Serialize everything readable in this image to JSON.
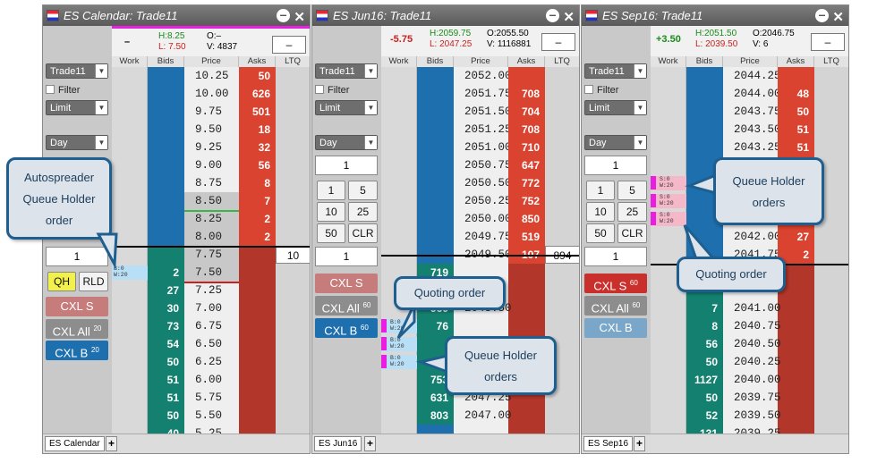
{
  "panels": [
    {
      "title": "ES Calendar: Trade11",
      "change": "–",
      "high": "H:8.25",
      "low": "L: 7.50",
      "open": "O:–",
      "volume": "V: 4837",
      "box": "–",
      "headers": [
        "Work",
        "Bids",
        "Price",
        "Asks",
        "LTQ"
      ],
      "rows": [
        {
          "price": "10.25",
          "bid": "",
          "ask": "50",
          "ltq": ""
        },
        {
          "price": "10.00",
          "bid": "",
          "ask": "626",
          "ltq": ""
        },
        {
          "price": "9.75",
          "bid": "",
          "ask": "501",
          "ltq": ""
        },
        {
          "price": "9.50",
          "bid": "",
          "ask": "18",
          "ltq": ""
        },
        {
          "price": "9.25",
          "bid": "",
          "ask": "32",
          "ltq": ""
        },
        {
          "price": "9.00",
          "bid": "",
          "ask": "56",
          "ltq": ""
        },
        {
          "price": "8.75",
          "bid": "",
          "ask": "8",
          "ltq": ""
        },
        {
          "price": "8.50",
          "bid": "",
          "ask": "7",
          "ltq": ""
        },
        {
          "price": "8.25",
          "bid": "",
          "ask": "2",
          "ltq": ""
        },
        {
          "price": "8.00",
          "bid": "",
          "ask": "2",
          "ltq": ""
        },
        {
          "price": "7.75",
          "bid": "",
          "ask": "",
          "ltq": "10"
        },
        {
          "price": "7.50",
          "bid": "2",
          "ask": "",
          "ltq": ""
        },
        {
          "price": "7.25",
          "bid": "27",
          "ask": "",
          "ltq": ""
        },
        {
          "price": "7.00",
          "bid": "30",
          "ask": "",
          "ltq": ""
        },
        {
          "price": "6.75",
          "bid": "73",
          "ask": "",
          "ltq": ""
        },
        {
          "price": "6.50",
          "bid": "54",
          "ask": "",
          "ltq": ""
        },
        {
          "price": "6.25",
          "bid": "50",
          "ask": "",
          "ltq": ""
        },
        {
          "price": "6.00",
          "bid": "51",
          "ask": "",
          "ltq": ""
        },
        {
          "price": "5.75",
          "bid": "51",
          "ask": "",
          "ltq": ""
        },
        {
          "price": "5.50",
          "bid": "50",
          "ask": "",
          "ltq": ""
        },
        {
          "price": "5.25",
          "bid": "40",
          "ask": "",
          "ltq": ""
        }
      ],
      "account": "Trade11",
      "filter": "Filter",
      "order_type": "Limit",
      "tif": "Day",
      "qty": "1",
      "qh": "QH",
      "rld": "RLD",
      "cxl_s": "CXL S",
      "cxl_all": "CXL All",
      "cxl_all_count": "20",
      "cxl_b": "CXL B",
      "cxl_b_count": "20",
      "tab": "ES Calendar",
      "orders": [
        {
          "line1": "B:0",
          "line2": "W:20"
        }
      ]
    },
    {
      "title": "ES Jun16: Trade11",
      "change": "-5.75",
      "high": "H:2059.75",
      "low": "L: 2047.25",
      "open": "O:2055.50",
      "volume": "V: 1116881",
      "box": "–",
      "headers": [
        "Work",
        "Bids",
        "Price",
        "Asks",
        "LTQ"
      ],
      "rows": [
        {
          "price": "2052.00",
          "bid": "",
          "ask": "",
          "ltq": ""
        },
        {
          "price": "2051.75",
          "bid": "",
          "ask": "708",
          "ltq": ""
        },
        {
          "price": "2051.50",
          "bid": "",
          "ask": "704",
          "ltq": ""
        },
        {
          "price": "2051.25",
          "bid": "",
          "ask": "708",
          "ltq": ""
        },
        {
          "price": "2051.00",
          "bid": "",
          "ask": "710",
          "ltq": ""
        },
        {
          "price": "2050.75",
          "bid": "",
          "ask": "647",
          "ltq": ""
        },
        {
          "price": "2050.50",
          "bid": "",
          "ask": "772",
          "ltq": ""
        },
        {
          "price": "2050.25",
          "bid": "",
          "ask": "752",
          "ltq": ""
        },
        {
          "price": "2050.00",
          "bid": "",
          "ask": "850",
          "ltq": ""
        },
        {
          "price": "2049.75",
          "bid": "",
          "ask": "519",
          "ltq": ""
        },
        {
          "price": "2049.50",
          "bid": "",
          "ask": "107",
          "ltq": "894"
        },
        {
          "price": "",
          "bid": "719",
          "ask": "",
          "ltq": ""
        },
        {
          "price": "",
          "bid": "",
          "ask": "",
          "ltq": ""
        },
        {
          "price": "2048.50",
          "bid": "960",
          "ask": "",
          "ltq": ""
        },
        {
          "price": "",
          "bid": "76",
          "ask": "",
          "ltq": ""
        },
        {
          "price": "",
          "bid": "",
          "ask": "",
          "ltq": ""
        },
        {
          "price": "",
          "bid": "",
          "ask": "",
          "ltq": ""
        },
        {
          "price": "",
          "bid": "753",
          "ask": "",
          "ltq": ""
        },
        {
          "price": "2047.25",
          "bid": "631",
          "ask": "",
          "ltq": ""
        },
        {
          "price": "2047.00",
          "bid": "803",
          "ask": "",
          "ltq": ""
        }
      ],
      "account": "Trade11",
      "filter": "Filter",
      "order_type": "Limit",
      "tif": "Day",
      "qty": "1",
      "keypad": [
        "1",
        "5",
        "10",
        "25",
        "50",
        "CLR"
      ],
      "qty2": "1",
      "cxl_s": "CXL S",
      "cxl_all": "CXL All",
      "cxl_all_count": "60",
      "cxl_b": "CXL B",
      "cxl_b_count": "60",
      "tab": "ES Jun16",
      "orders": [
        {
          "line1": "B:0",
          "line2": "W:20"
        },
        {
          "line1": "B:0",
          "line2": "W:20"
        },
        {
          "line1": "B:0",
          "line2": "W:20"
        }
      ]
    },
    {
      "title": "ES Sep16: Trade11",
      "change": "+3.50",
      "high": "H:2051.50",
      "low": "L: 2039.50",
      "open": "O:2046.75",
      "volume": "V: 6",
      "box": "–",
      "headers": [
        "Work",
        "Bids",
        "Price",
        "Asks",
        "LTQ"
      ],
      "rows": [
        {
          "price": "2044.25",
          "bid": "",
          "ask": "",
          "ltq": ""
        },
        {
          "price": "2044.00",
          "bid": "",
          "ask": "48",
          "ltq": ""
        },
        {
          "price": "2043.75",
          "bid": "",
          "ask": "50",
          "ltq": ""
        },
        {
          "price": "2043.50",
          "bid": "",
          "ask": "51",
          "ltq": ""
        },
        {
          "price": "2043.25",
          "bid": "",
          "ask": "51",
          "ltq": ""
        },
        {
          "price": "",
          "bid": "",
          "ask": "",
          "ltq": ""
        },
        {
          "price": "",
          "bid": "",
          "ask": "",
          "ltq": ""
        },
        {
          "price": "",
          "bid": "",
          "ask": "",
          "ltq": ""
        },
        {
          "price": "",
          "bid": "",
          "ask": "",
          "ltq": ""
        },
        {
          "price": "2042.00",
          "bid": "",
          "ask": "27",
          "ltq": ""
        },
        {
          "price": "2041.75",
          "bid": "",
          "ask": "2",
          "ltq": ""
        },
        {
          "price": "",
          "bid": "",
          "ask": "",
          "ltq": ""
        },
        {
          "price": "",
          "bid": "",
          "ask": "",
          "ltq": ""
        },
        {
          "price": "2041.00",
          "bid": "7",
          "ask": "",
          "ltq": ""
        },
        {
          "price": "2040.75",
          "bid": "8",
          "ask": "",
          "ltq": ""
        },
        {
          "price": "2040.50",
          "bid": "56",
          "ask": "",
          "ltq": ""
        },
        {
          "price": "2040.25",
          "bid": "50",
          "ask": "",
          "ltq": ""
        },
        {
          "price": "2040.00",
          "bid": "1127",
          "ask": "",
          "ltq": ""
        },
        {
          "price": "2039.75",
          "bid": "50",
          "ask": "",
          "ltq": ""
        },
        {
          "price": "2039.50",
          "bid": "52",
          "ask": "",
          "ltq": ""
        },
        {
          "price": "2039.25",
          "bid": "131",
          "ask": "",
          "ltq": ""
        }
      ],
      "account": "Trade11",
      "filter": "Filter",
      "order_type": "Limit",
      "tif": "Day",
      "qty": "1",
      "keypad": [
        "1",
        "5",
        "10",
        "25",
        "50",
        "CLR"
      ],
      "qty2": "1",
      "cxl_s": "CXL S",
      "cxl_s_count": "60",
      "cxl_all": "CXL All",
      "cxl_all_count": "60",
      "cxl_b": "CXL B",
      "tab": "ES Sep16",
      "orders": [
        {
          "line1": "S:0",
          "line2": "W:20"
        },
        {
          "line1": "S:0",
          "line2": "W:20"
        },
        {
          "line1": "S:0",
          "line2": "W:20"
        }
      ]
    }
  ],
  "callouts": {
    "autospreader": "Autospreader Queue Holder order",
    "quoting_jun": "Quoting order",
    "queue_holder_jun": "Queue Holder orders",
    "queue_holder_sep": "Queue Holder orders",
    "quoting_sep": "Quoting order"
  },
  "colors": {
    "bid": "#1e6fae",
    "ask": "#b3362b",
    "order_marker": "#e91ee0",
    "callout_border": "#1f5f8f"
  }
}
